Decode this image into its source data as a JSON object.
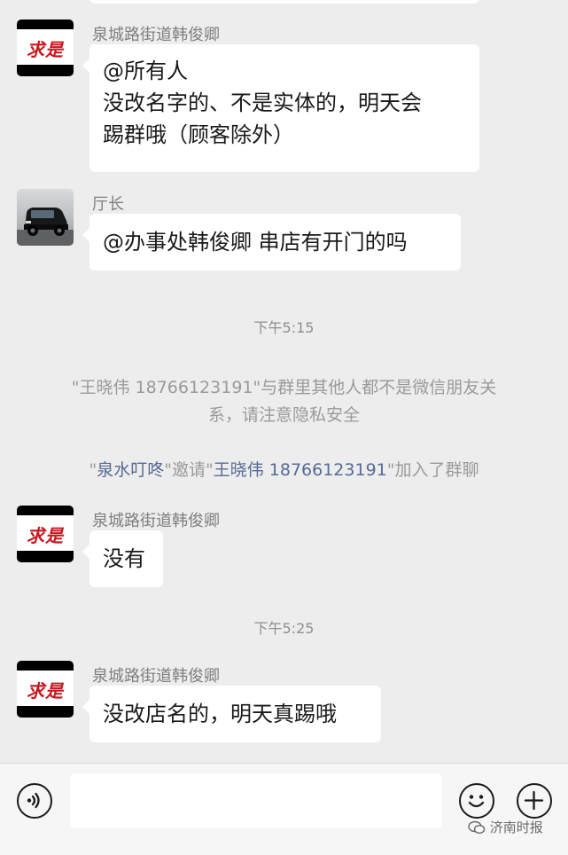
{
  "messages": [
    {
      "sender": "泉城路街道韩俊卿",
      "lines": [
        "@所有人",
        "没改名字的、不是实体的，明天会",
        "踢群哦（顾客除外）"
      ]
    },
    {
      "sender": "厅长",
      "lines": [
        "@办事处韩俊卿  串店有开门的吗"
      ]
    },
    {
      "sender": "泉城路街道韩俊卿",
      "lines": [
        "没有"
      ]
    },
    {
      "sender": "泉城路街道韩俊卿",
      "lines": [
        "没改店名的，明天真踢哦"
      ]
    }
  ],
  "timestamps": [
    "下午5:15",
    "下午5:25"
  ],
  "system_notices": {
    "privacy_line1": "\"王晓伟 18766123191\"与群里其他人都不是微信朋友关",
    "privacy_line2": "系，请注意隐私安全",
    "invite_q1": "\"",
    "invite_inviter": "泉水叮咚",
    "invite_q2": "\"邀请\"",
    "invite_invitee": "王晓伟 18766123191",
    "invite_tail": "\"加入了群聊"
  },
  "avatar_logo_text": "求是",
  "input_bar": {
    "voice_icon": "voice-icon",
    "emoji_icon": "emoji-icon",
    "plus_icon": "plus-icon"
  },
  "watermark": "济南时报",
  "colors": {
    "background": "#ededed",
    "bubble": "#ffffff",
    "link": "#576b95",
    "system_text": "#9a9a9a"
  }
}
